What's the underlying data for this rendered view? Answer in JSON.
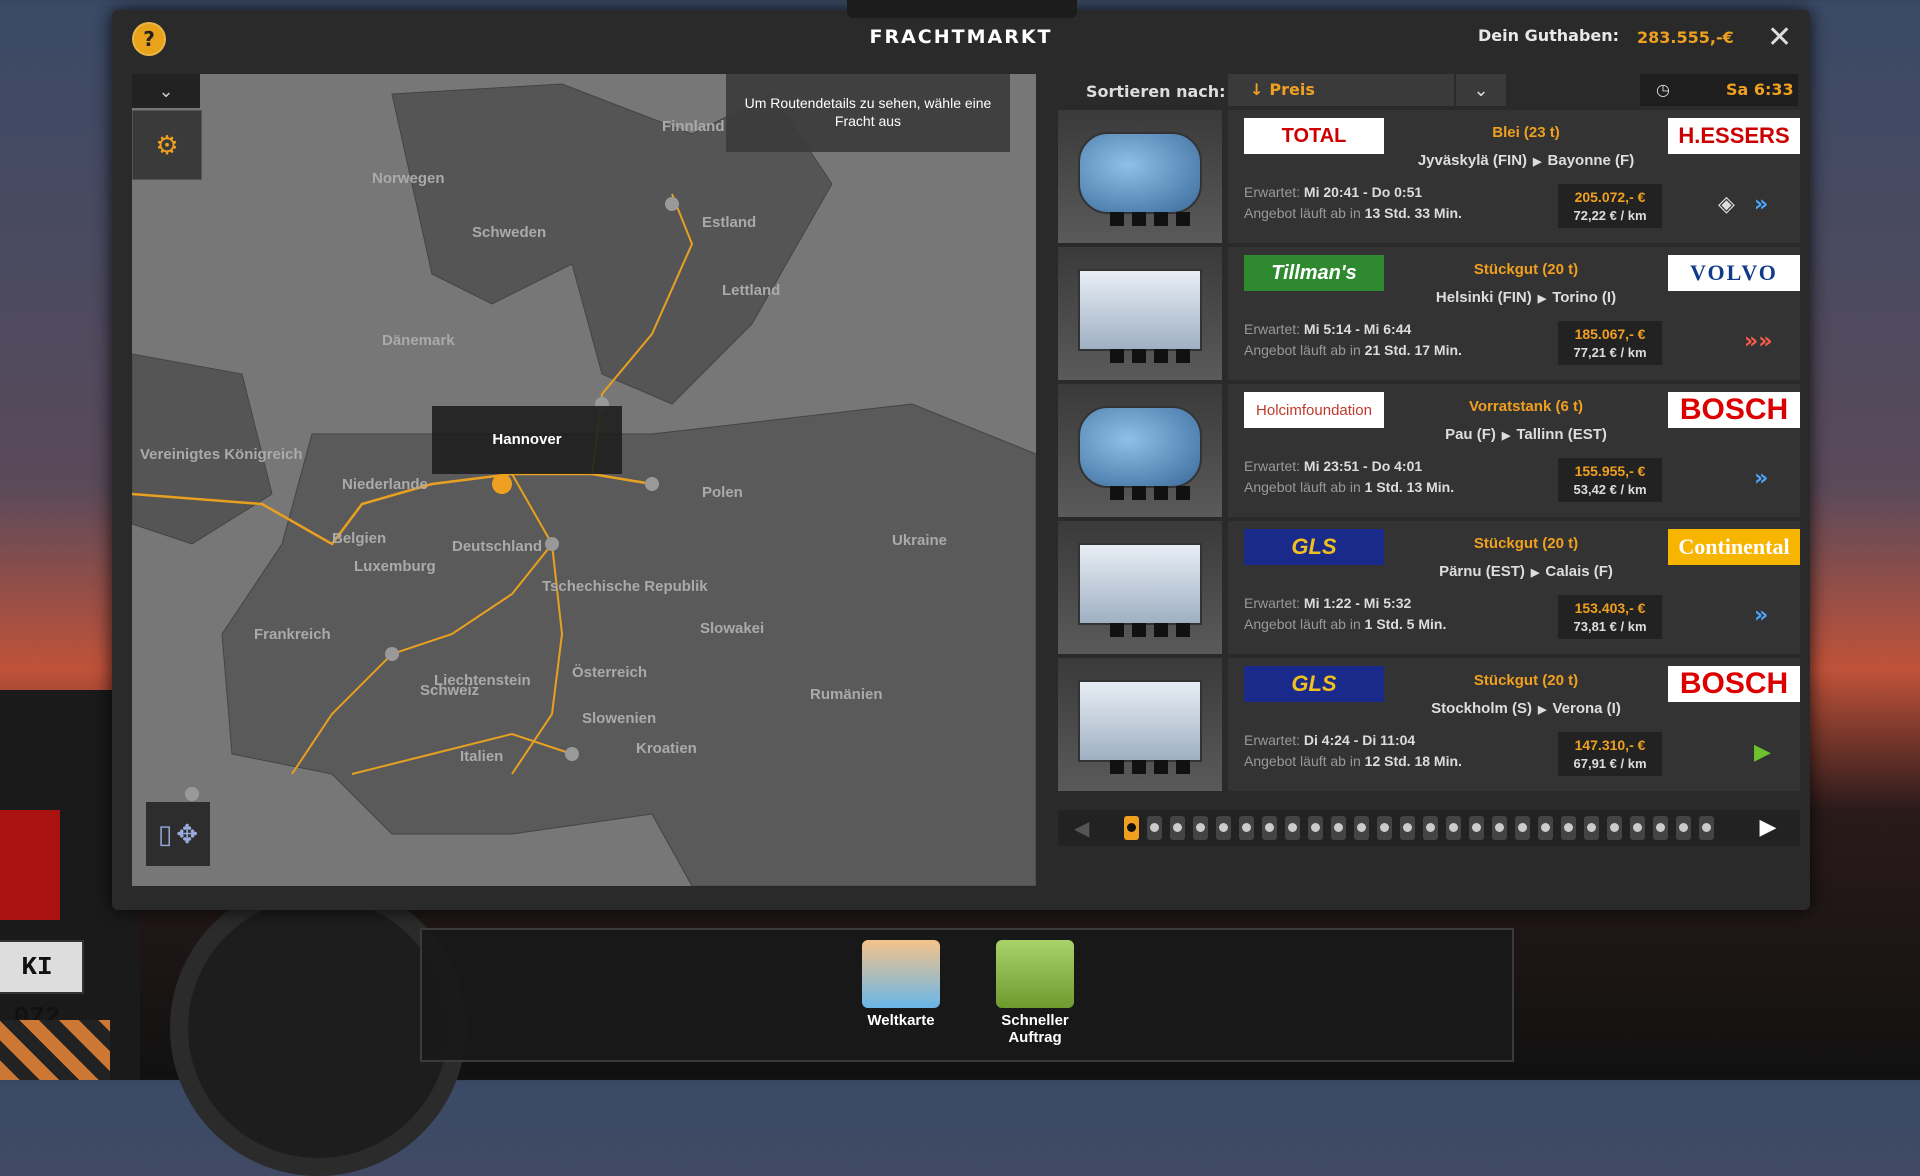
{
  "header": {
    "title": "FRACHTMARKT",
    "balance_label": "Dein Guthaben:",
    "balance_value": "283.555,-€",
    "help_label": "?",
    "close_label": "✕"
  },
  "map": {
    "info_text": "Um Routendetails zu sehen, wähle eine Fracht aus",
    "tooltip": "Hannover",
    "labels": [
      "Norwegen",
      "Finnland",
      "Schweden",
      "Estland",
      "Lettland",
      "Dänemark",
      "Vereinigtes Königreich",
      "Niederlande",
      "Deutschland",
      "Belgien",
      "Polen",
      "Luxemburg",
      "Tschechische Republik",
      "Ukraine",
      "Frankreich",
      "Slowakei",
      "Liechtenstein",
      "Österreich",
      "Schweiz",
      "Rumänien",
      "Slowenien",
      "Italien",
      "Kroatien"
    ]
  },
  "sort": {
    "label": "Sortieren nach:",
    "selected": "Preis"
  },
  "clock": {
    "time": "Sa 6:33"
  },
  "offers": [
    {
      "sender": "TOTAL",
      "receiver": "H.ESSERS",
      "cargo": "Blei (23 t)",
      "from": "Jyväskylä (FIN)",
      "to": "Bayonne (F)",
      "expected_label": "Erwartet:",
      "expected": "Mi 20:41 - Do 0:51",
      "expires_label": "Angebot läuft ab in",
      "expires": "13 Std. 33 Min.",
      "price": "205.072,- €",
      "per_km": "72,22 € / km",
      "action": "»"
    },
    {
      "sender": "Tillman's",
      "receiver": "VOLVO",
      "cargo": "Stückgut (20 t)",
      "from": "Helsinki (FIN)",
      "to": "Torino (I)",
      "expected_label": "Erwartet:",
      "expected": "Mi 5:14 - Mi 6:44",
      "expires_label": "Angebot läuft ab in",
      "expires": "21 Std. 17 Min.",
      "price": "185.067,- €",
      "per_km": "77,21 € / km",
      "action": "»»"
    },
    {
      "sender": "Holcimfoundation",
      "receiver": "BOSCH",
      "cargo": "Vorratstank (6 t)",
      "from": "Pau (F)",
      "to": "Tallinn (EST)",
      "expected_label": "Erwartet:",
      "expected": "Mi 23:51 - Do 4:01",
      "expires_label": "Angebot läuft ab in",
      "expires": "1 Std. 13 Min.",
      "price": "155.955,- €",
      "per_km": "53,42 € / km",
      "action": "»"
    },
    {
      "sender": "GLS",
      "receiver": "Continental",
      "cargo": "Stückgut (20 t)",
      "from": "Pärnu (EST)",
      "to": "Calais (F)",
      "expected_label": "Erwartet:",
      "expected": "Mi 1:22 - Mi 5:32",
      "expires_label": "Angebot läuft ab in",
      "expires": "1 Std. 5 Min.",
      "price": "153.403,- €",
      "per_km": "73,81 € / km",
      "action": "»"
    },
    {
      "sender": "GLS",
      "receiver": "BOSCH",
      "cargo": "Stückgut (20 t)",
      "from": "Stockholm (S)",
      "to": "Verona (I)",
      "expected_label": "Erwartet:",
      "expected": "Di 4:24 - Di 11:04",
      "expires_label": "Angebot läuft ab in",
      "expires": "12 Std. 18 Min.",
      "price": "147.310,- €",
      "per_km": "67,91 € / km",
      "action": "▶"
    }
  ],
  "bottom": {
    "world_map": "Weltkarte",
    "quick_job_line1": "Schneller",
    "quick_job_line2": "Auftrag"
  },
  "background": {
    "plate": "KI 072"
  },
  "colors": {
    "accent": "#f0a020",
    "panel": "#2a2a2a"
  }
}
